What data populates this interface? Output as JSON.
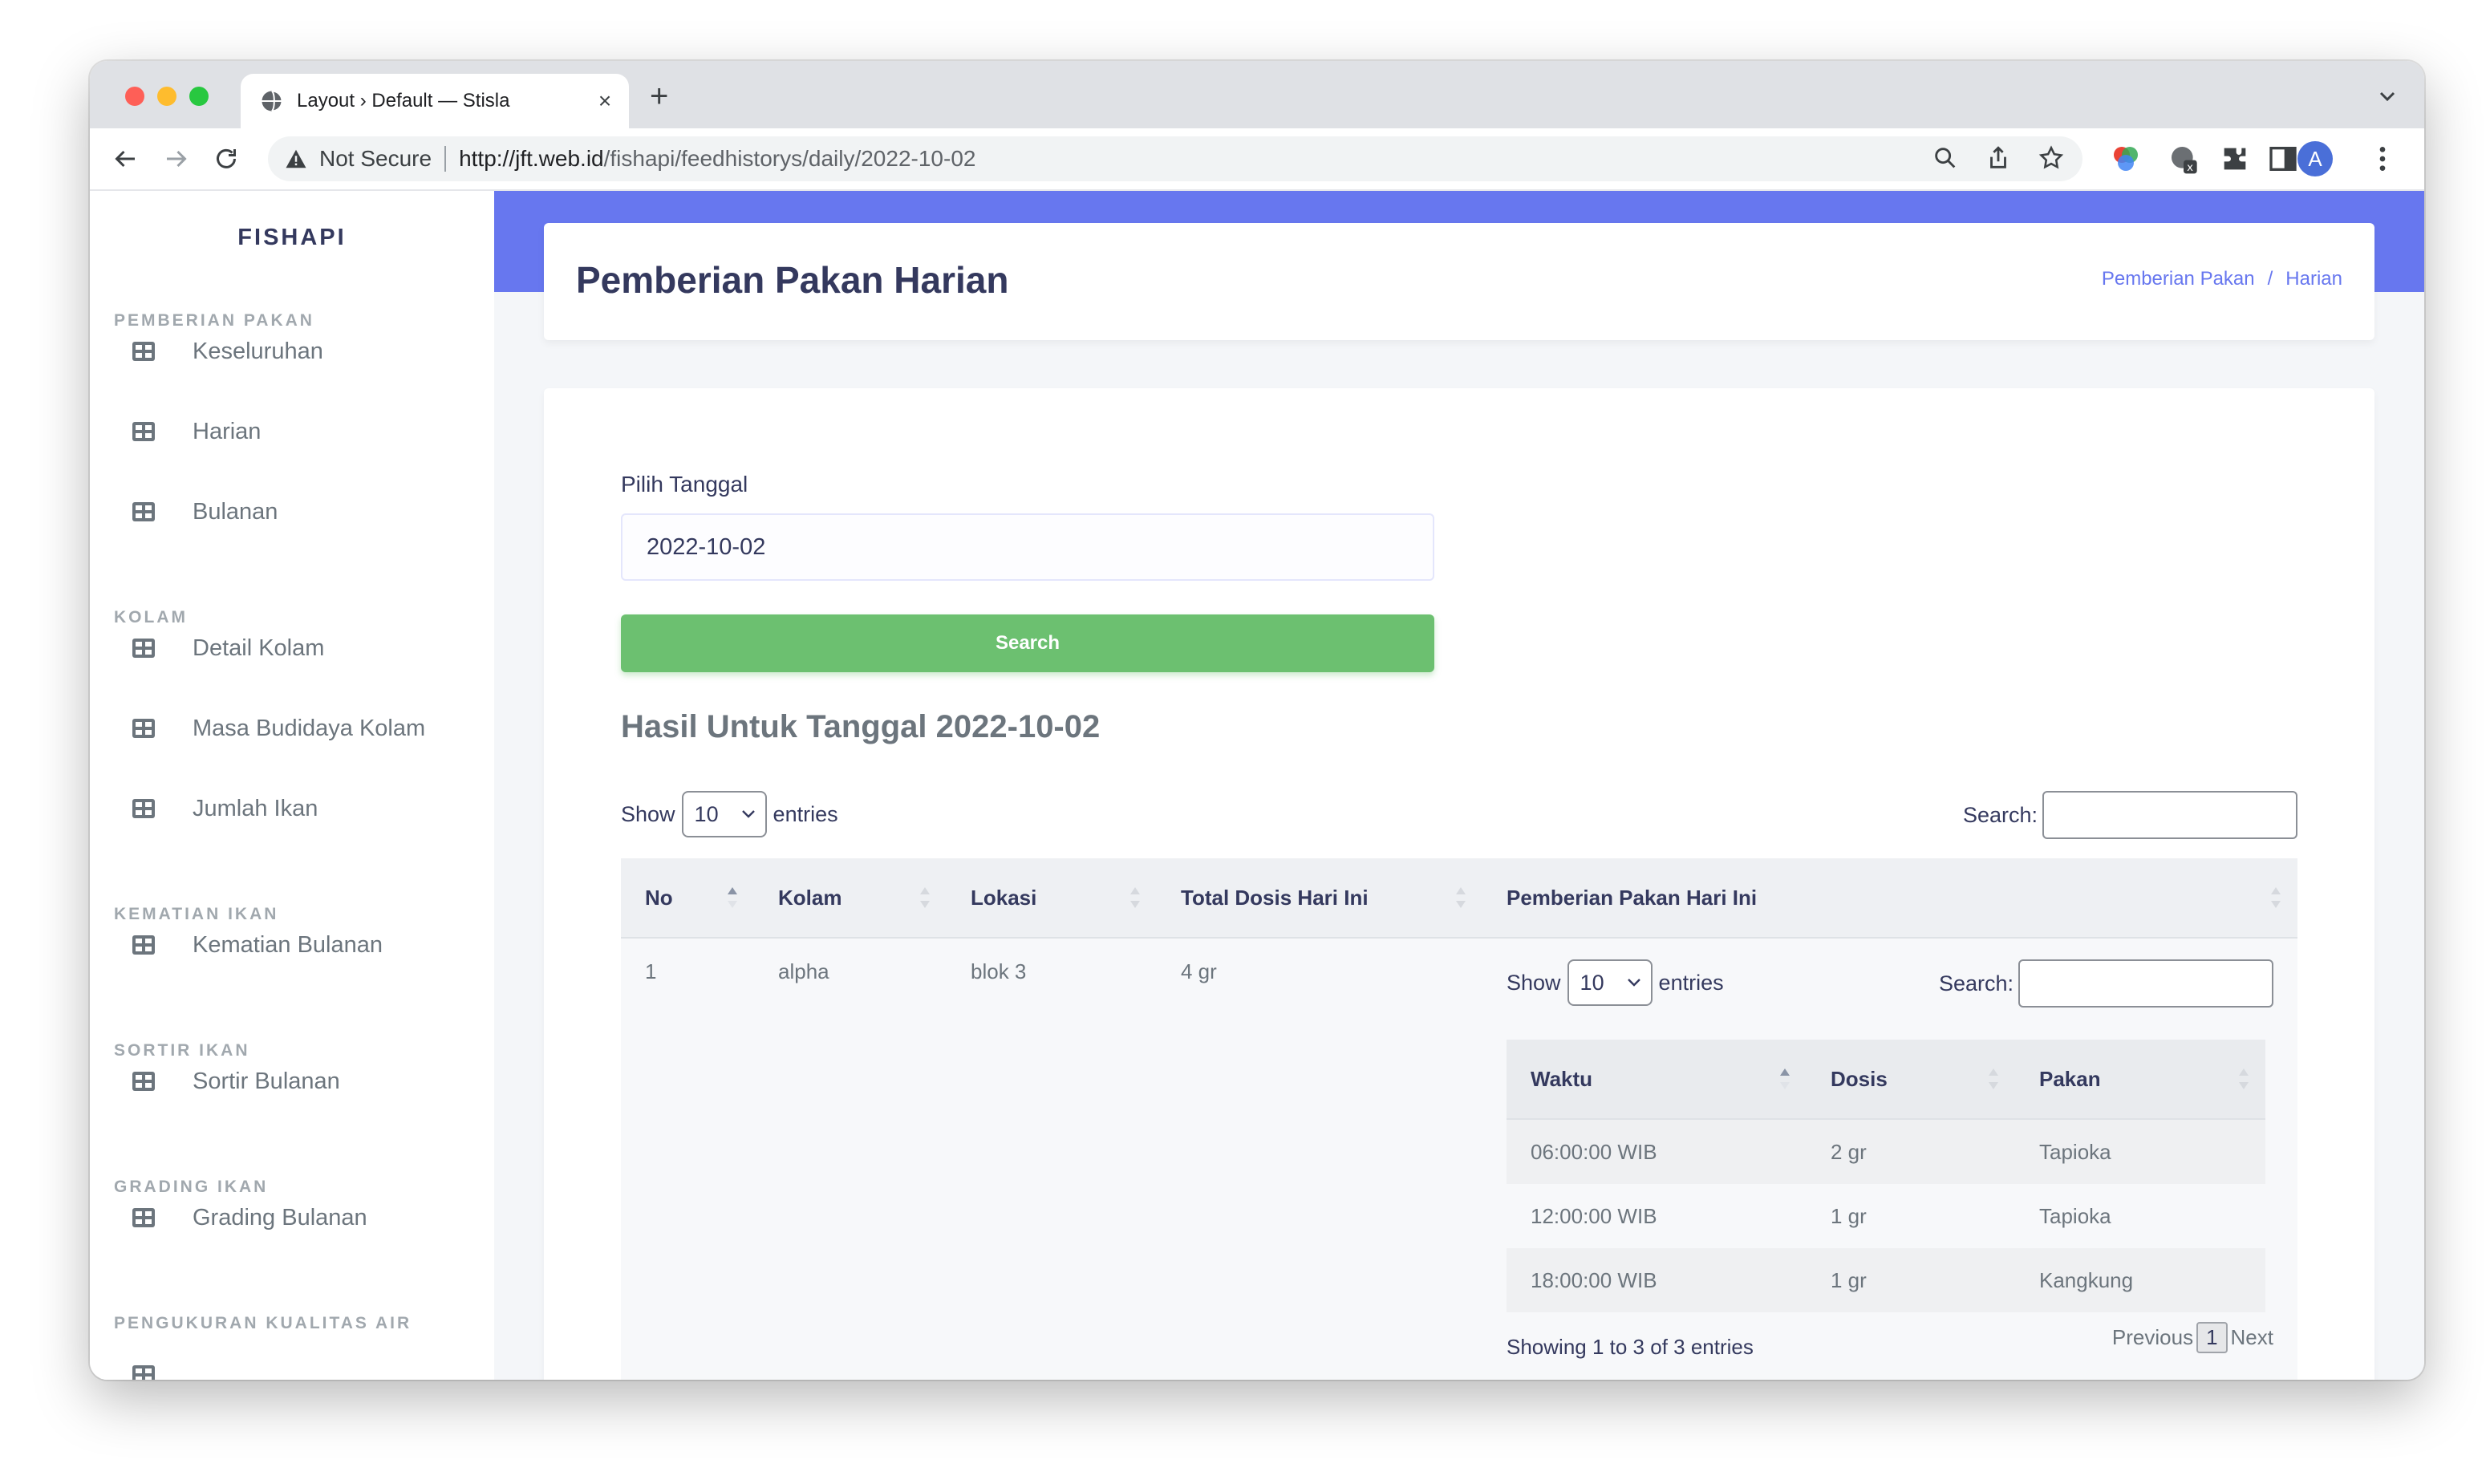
{
  "browser": {
    "tab_title": "Layout › Default — Stisla",
    "security_label": "Not Secure",
    "url_host": "http://jft.web.id",
    "url_path": "/fishapi/feedhistorys/daily/2022-10-02",
    "profile_initial": "A"
  },
  "sidebar": {
    "brand": "FISHAPI",
    "sections": [
      {
        "header": "PEMBERIAN PAKAN",
        "items": [
          "Keseluruhan",
          "Harian",
          "Bulanan"
        ]
      },
      {
        "header": "KOLAM",
        "items": [
          "Detail Kolam",
          "Masa Budidaya Kolam",
          "Jumlah Ikan"
        ]
      },
      {
        "header": "KEMATIAN IKAN",
        "items": [
          "Kematian Bulanan"
        ]
      },
      {
        "header": "SORTIR IKAN",
        "items": [
          "Sortir Bulanan"
        ]
      },
      {
        "header": "GRADING IKAN",
        "items": [
          "Grading Bulanan"
        ]
      },
      {
        "header": "PENGUKURAN KUALITAS AIR",
        "items": []
      }
    ]
  },
  "header": {
    "title": "Pemberian Pakan Harian",
    "breadcrumb": [
      "Pemberian Pakan",
      "Harian"
    ],
    "breadcrumb_separator": "/"
  },
  "form": {
    "date_label": "Pilih Tanggal",
    "date_value": "2022-10-02",
    "search_button": "Search"
  },
  "results": {
    "title": "Hasil Untuk Tanggal 2022-10-02",
    "show_label": "Show",
    "entries_label": "entries",
    "page_length": "10",
    "search_label": "Search:",
    "columns": [
      "No",
      "Kolam",
      "Lokasi",
      "Total Dosis Hari Ini",
      "Pemberian Pakan Hari Ini"
    ],
    "rows": [
      {
        "no": "1",
        "kolam": "alpha",
        "lokasi": "blok 3",
        "total_dosis": "4 gr",
        "nested": {
          "show_label": "Show",
          "page_length": "10",
          "entries_label": "entries",
          "search_label": "Search:",
          "columns": [
            "Waktu",
            "Dosis",
            "Pakan"
          ],
          "rows": [
            [
              "06:00:00 WIB",
              "2 gr",
              "Tapioka"
            ],
            [
              "12:00:00 WIB",
              "1 gr",
              "Tapioka"
            ],
            [
              "18:00:00 WIB",
              "1 gr",
              "Kangkung"
            ]
          ],
          "info": "Showing 1 to 3 of 3 entries",
          "prev_label": "Previous",
          "current_page": "1",
          "next_label": "Next"
        }
      }
    ]
  },
  "colors": {
    "primary": "#6777ef",
    "success": "#6cc070",
    "sidebar_bg": "#ffffff",
    "page_bg": "#f4f6f9"
  },
  "icons": {
    "menu_item": "table-grid-icon",
    "sort": "sort-arrows-icon"
  }
}
